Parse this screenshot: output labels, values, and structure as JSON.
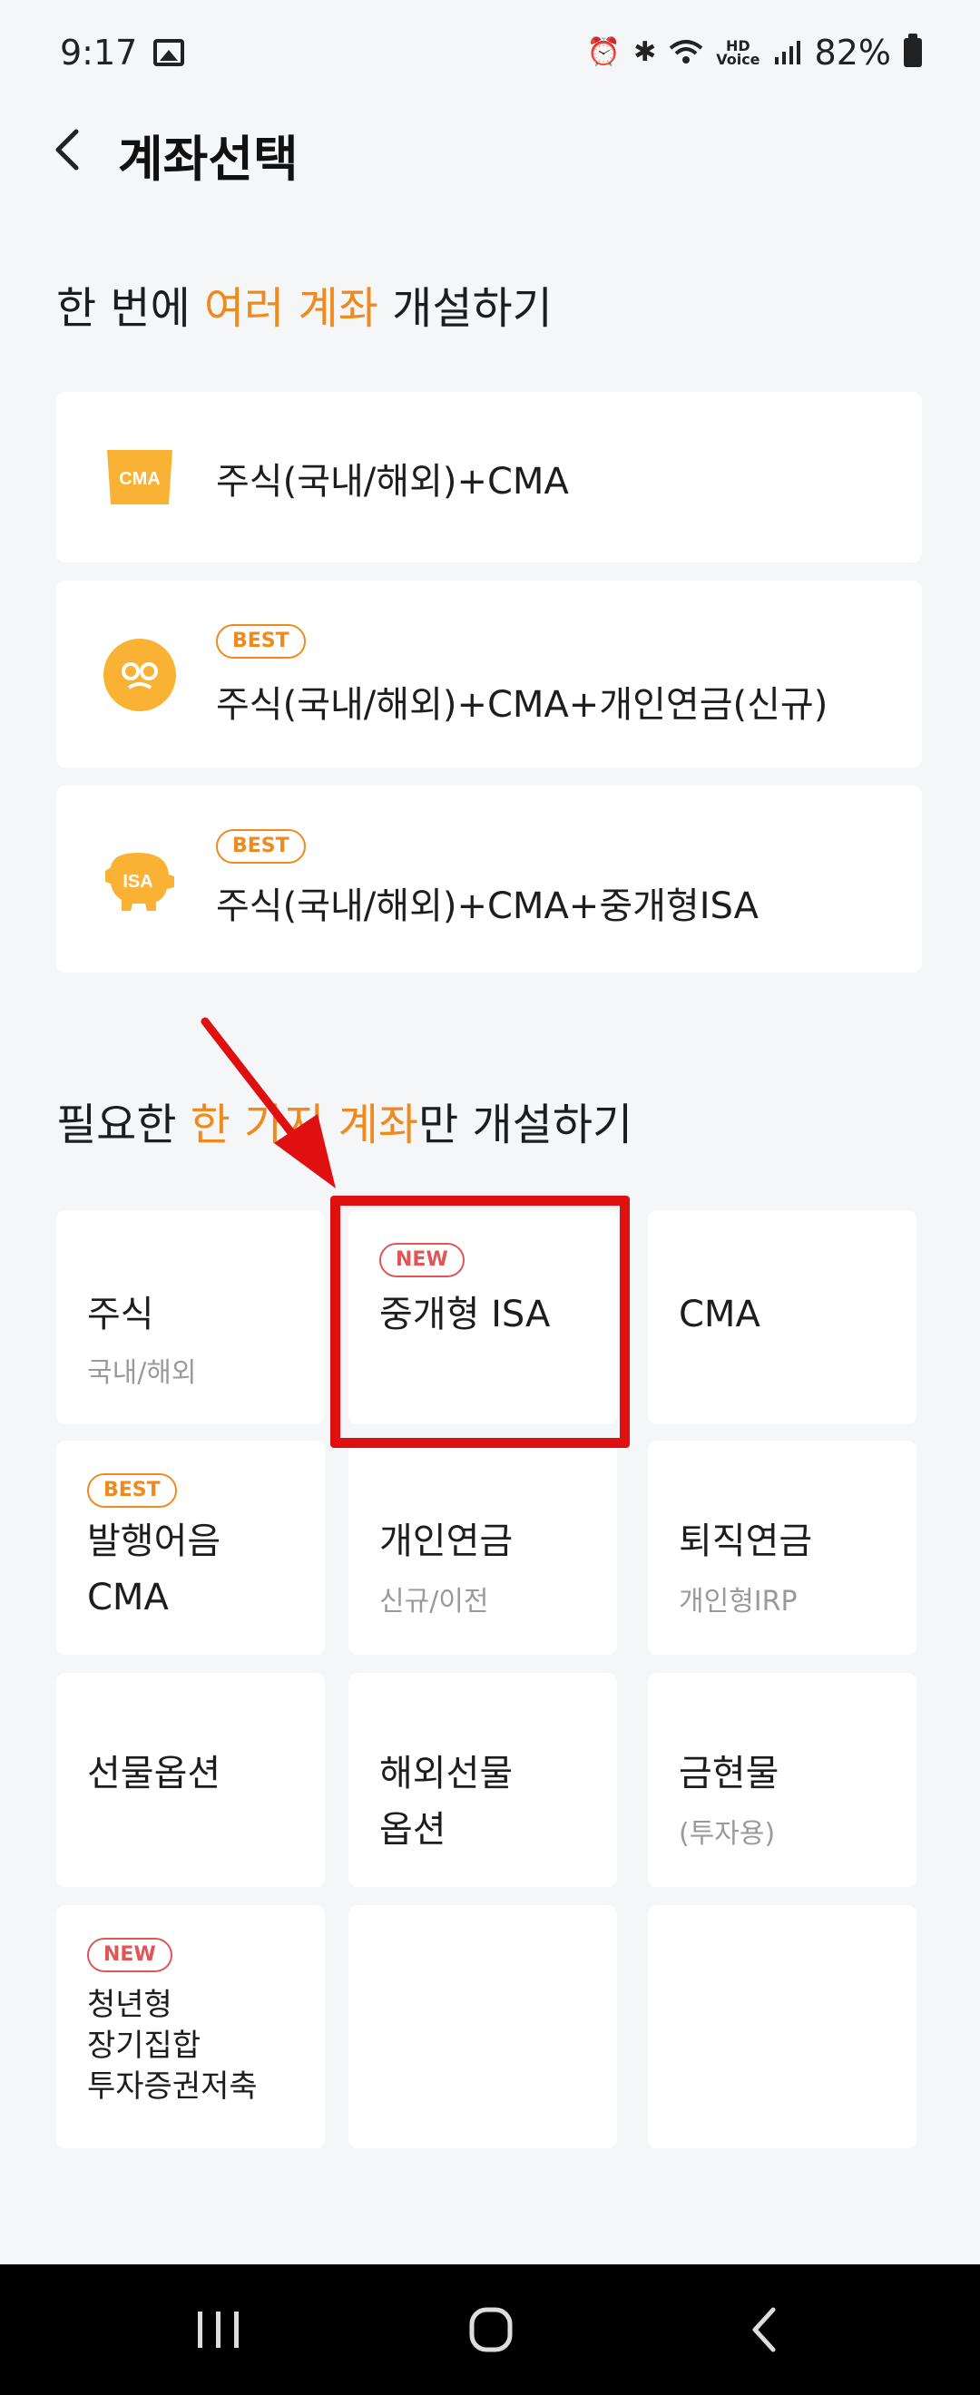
{
  "status_bar": {
    "time": "9:17",
    "battery": "82%",
    "hd_label": "HD\nVoice"
  },
  "header": {
    "title": "계좌선택"
  },
  "section1": {
    "pre": "한 번에 ",
    "highlight": "여러 계좌",
    "post": " 개설하기"
  },
  "bundle_cards": [
    {
      "icon": "cma-card-icon",
      "icon_text": "CMA",
      "badge": "",
      "label": "주식(국내/해외)+CMA"
    },
    {
      "icon": "pension-coin-icon",
      "badge": "BEST",
      "label": "주식(국내/해외)+CMA+개인연금(신규)"
    },
    {
      "icon": "isa-piggy-bank-icon",
      "icon_text": "ISA",
      "badge": "BEST",
      "label": "주식(국내/해외)+CMA+중개형ISA"
    }
  ],
  "section2": {
    "pre": "필요한 ",
    "highlight": "한 가지 계좌",
    "post": "만 개설하기"
  },
  "tiles": [
    {
      "title": "주식",
      "sub": "국내/해외",
      "badge": ""
    },
    {
      "title": "중개형 ISA",
      "sub": "",
      "badge": "NEW"
    },
    {
      "title": "CMA",
      "sub": "",
      "badge": ""
    },
    {
      "title": "발행어음\nCMA",
      "sub": "",
      "badge": "BEST"
    },
    {
      "title": "개인연금",
      "sub": "신규/이전",
      "badge": ""
    },
    {
      "title": "퇴직연금",
      "sub": "개인형IRP",
      "badge": ""
    },
    {
      "title": "선물옵션",
      "sub": "",
      "badge": ""
    },
    {
      "title": "해외선물\n옵션",
      "sub": "",
      "badge": ""
    },
    {
      "title": "금현물",
      "sub": "(투자용)",
      "badge": ""
    },
    {
      "title": "청년형\n장기집합\n투자증권저축",
      "sub": "",
      "badge": "NEW"
    }
  ],
  "colors": {
    "accent": "#f08a1c",
    "new_badge": "#e25555",
    "annotation": "#e01010",
    "background": "#f4f6f8"
  }
}
